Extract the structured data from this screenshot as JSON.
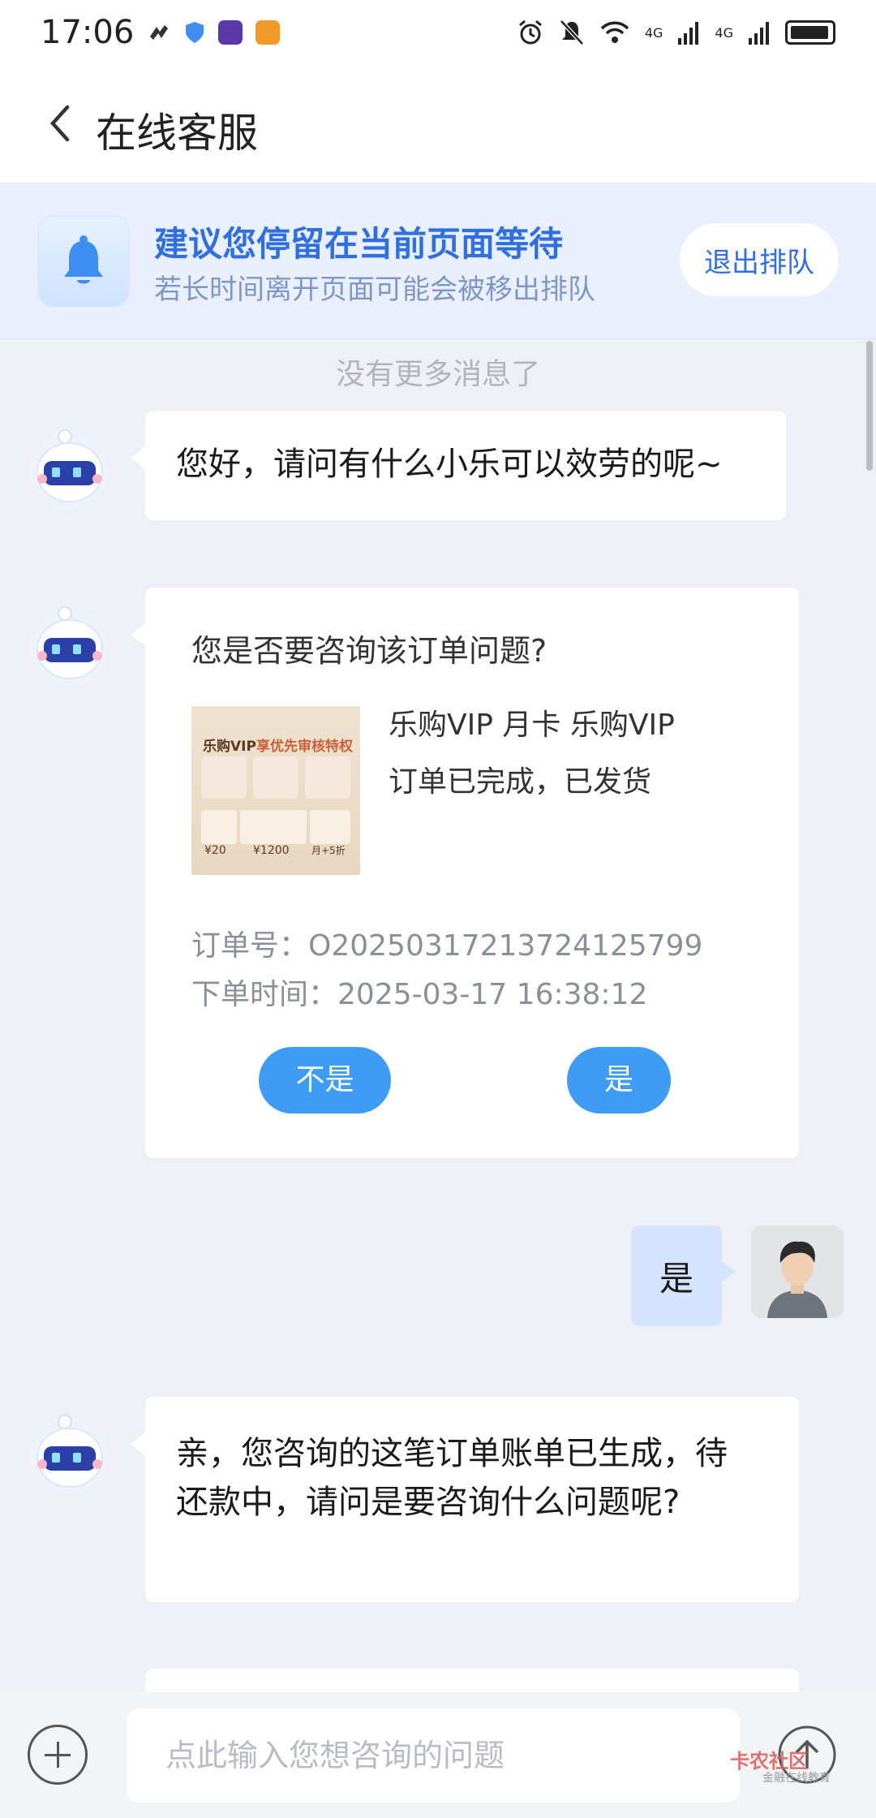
{
  "status_bar": {
    "time": "17:06",
    "signal_label_1": "4G",
    "signal_label_2": "4G"
  },
  "header": {
    "title": "在线客服"
  },
  "banner": {
    "title": "建议您停留在当前页面等待",
    "subtitle": "若长时间离开页面可能会被移出排队",
    "leave_button": "退出排队"
  },
  "chat": {
    "no_more": "没有更多消息了",
    "greeting": "您好，请问有什么小乐可以效劳的呢~",
    "order_card": {
      "question": "您是否要咨询该订单问题?",
      "thumb_title_a": "乐购VIP",
      "thumb_title_b": "享优先审核特权",
      "thumb_values": [
        "¥20",
        "¥1200",
        "月+5折"
      ],
      "product_name": "乐购VIP 月卡 乐购VIP",
      "status": "订单已完成，已发货",
      "order_no": "订单号：O20250317213724125799",
      "order_time": "下单时间：2025-03-17 16:38:12",
      "no_button": "不是",
      "yes_button": "是"
    },
    "user_reply": "是",
    "reply_text": "亲，您咨询的这笔订单账单已生成，待还款中，请问是要咨询什么问题呢?"
  },
  "input_bar": {
    "placeholder": "点此输入您想咨询的问题"
  },
  "watermark": {
    "title": "卡农社区",
    "subtitle": "金融在线教育"
  },
  "colors": {
    "accent": "#2f6fe0",
    "button": "#3f9cf5",
    "user_bubble": "#d6e3ff",
    "background": "#eef0f5"
  }
}
